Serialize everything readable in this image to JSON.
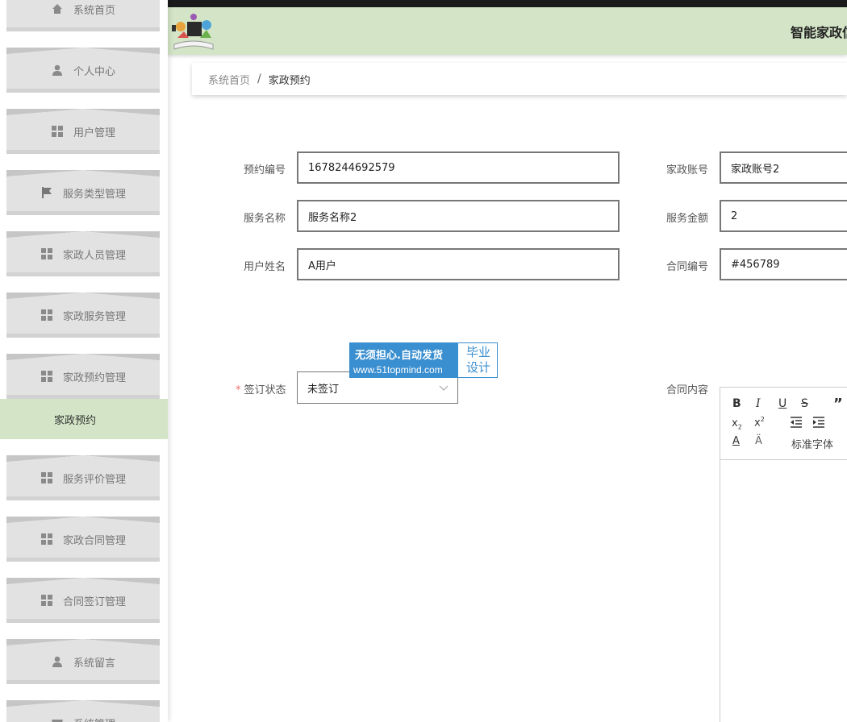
{
  "sidebar": {
    "items": [
      {
        "label": "系统首页",
        "icon": "home-icon"
      },
      {
        "label": "个人中心",
        "icon": "person-icon"
      },
      {
        "label": "用户管理",
        "icon": "grid-icon"
      },
      {
        "label": "服务类型管理",
        "icon": "flag-icon"
      },
      {
        "label": "家政人员管理",
        "icon": "grid-icon"
      },
      {
        "label": "家政服务管理",
        "icon": "grid-icon"
      },
      {
        "label": "家政预约管理",
        "icon": "grid-icon"
      },
      {
        "label": "服务评价管理",
        "icon": "grid-icon"
      },
      {
        "label": "家政合同管理",
        "icon": "grid-icon"
      },
      {
        "label": "合同签订管理",
        "icon": "grid-icon"
      },
      {
        "label": "系统留言",
        "icon": "person-icon"
      },
      {
        "label": "系统管理",
        "icon": "gear-icon"
      }
    ],
    "active_sub": "家政预约"
  },
  "header": {
    "title": "智能家政信息管理系统"
  },
  "breadcrumb": {
    "home": "系统首页",
    "separator": "/",
    "current": "家政预约"
  },
  "form": {
    "booking_no": {
      "label": "预约编号",
      "value": "1678244692579"
    },
    "service_name": {
      "label": "服务名称",
      "value": "服务名称2"
    },
    "user_name": {
      "label": "用户姓名",
      "value": "A用户"
    },
    "account": {
      "label": "家政账号",
      "value": "家政账号2"
    },
    "amount": {
      "label": "服务金额",
      "value": "2"
    },
    "contract_no": {
      "label": "合同编号",
      "value": "#456789"
    },
    "sign_status": {
      "required_mark": "*",
      "label": "签订状态",
      "value": "未签订"
    },
    "contract_content": {
      "label": "合同内容"
    }
  },
  "editor": {
    "font_label": "标准字体"
  },
  "watermark": {
    "line1": "无须担心.自动发货",
    "line2": "www.51topmind.com",
    "right1": "毕业",
    "right2": "设计"
  },
  "colors": {
    "header_bg": "#d3e5c6",
    "active_sub_bg": "#d3e5c6",
    "menu_bg": "#e2e2e2",
    "watermark_blue": "#3a8fd0",
    "required": "#f56c6c"
  }
}
